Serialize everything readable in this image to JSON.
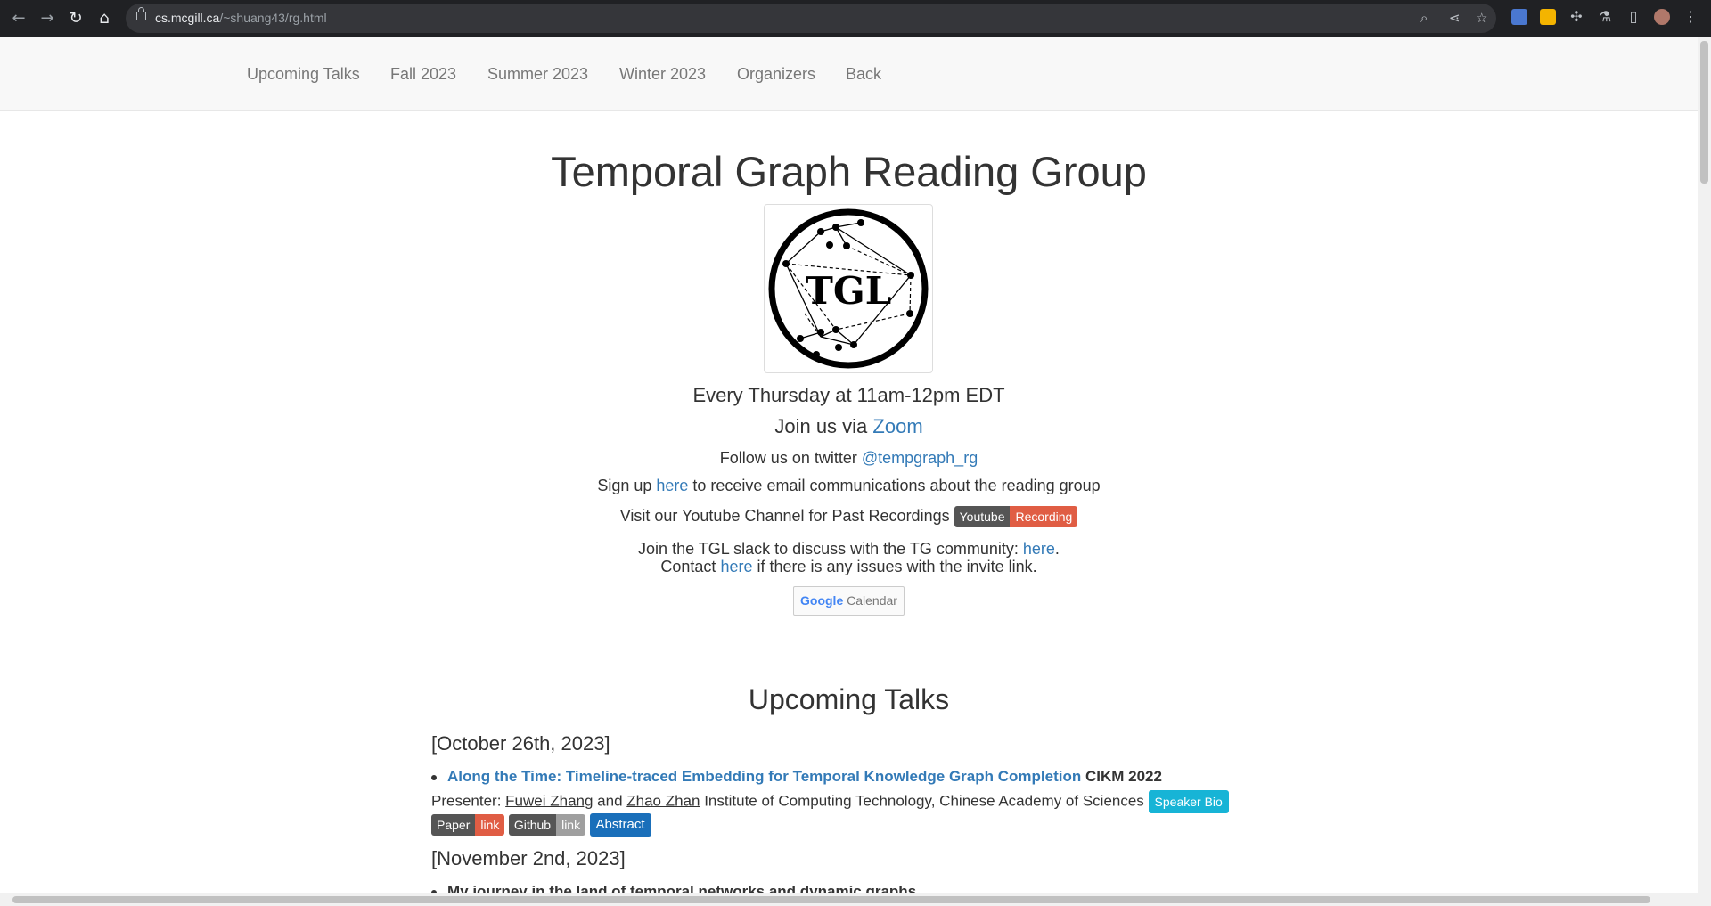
{
  "browser": {
    "url_host": "cs.mcgill.ca",
    "url_path": "/~shuang43/rg.html"
  },
  "nav": {
    "items": [
      "Upcoming Talks",
      "Fall 2023",
      "Summer 2023",
      "Winter 2023",
      "Organizers",
      "Back"
    ]
  },
  "header": {
    "title": "Temporal Graph Reading Group",
    "logo_text": "TGL",
    "schedule": "Every Thursday at 11am-12pm EDT",
    "join_prefix": "Join us via ",
    "join_link": "Zoom",
    "twitter_prefix": "Follow us on twitter ",
    "twitter_handle": "@tempgraph_rg",
    "signup_prefix": "Sign up ",
    "signup_link": "here",
    "signup_suffix": " to receive email communications about the reading group",
    "youtube_text": "Visit our Youtube Channel for Past Recordings",
    "youtube_badge_left": "Youtube",
    "youtube_badge_right": "Recording",
    "slack_prefix": "Join the TGL slack to discuss with the TG community: ",
    "slack_link": "here",
    "slack_suffix": ".",
    "contact_prefix": "Contact ",
    "contact_link": "here",
    "contact_suffix": " if there is any issues with the invite link.",
    "gcal_google": "Google",
    "gcal_calendar": "Calendar"
  },
  "upcoming": {
    "heading": "Upcoming Talks",
    "talks": [
      {
        "date": "[October 26th, 2023]",
        "title": "Along the Time: Timeline-traced Embedding for Temporal Knowledge Graph Completion",
        "venue": " CIKM 2022",
        "presenter_label": "Presenter: ",
        "presenter1": "Fuwei Zhang",
        "and": " and ",
        "presenter2": "Zhao Zhan",
        "affiliation": " Institute of Computing Technology, Chinese Academy of Sciences ",
        "bio_button": "Speaker Bio",
        "paper_left": "Paper",
        "paper_right": "link",
        "github_left": "Github",
        "github_right": "link",
        "abstract_button": "Abstract"
      },
      {
        "date": "[November 2nd, 2023]",
        "title": "My journey in the land of temporal networks and dynamic graphs"
      }
    ]
  }
}
